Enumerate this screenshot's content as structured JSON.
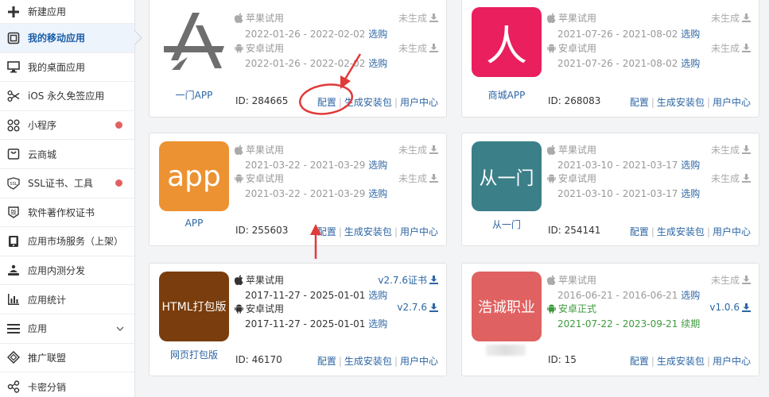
{
  "sidebar": {
    "items": [
      {
        "label": "新建应用",
        "icon": "plus-icon"
      },
      {
        "label": "我的移动应用",
        "icon": "mobile-app-icon",
        "active": true
      },
      {
        "label": "我的桌面应用",
        "icon": "desktop-icon"
      },
      {
        "label": "iOS 永久免签应用",
        "icon": "scissors-icon"
      },
      {
        "label": "小程序",
        "icon": "mini-program-icon",
        "dot": true
      },
      {
        "label": "云商城",
        "icon": "store-icon"
      },
      {
        "label": "SSL证书、工具",
        "icon": "ssl-icon",
        "dot": true
      },
      {
        "label": "软件著作权证书",
        "icon": "copyright-icon"
      },
      {
        "label": "应用市场服务（上架）",
        "icon": "market-icon"
      },
      {
        "label": "应用内测分发",
        "icon": "distribution-icon"
      },
      {
        "label": "应用统计",
        "icon": "bar-chart-icon"
      },
      {
        "label": "应用",
        "icon": "menu-icon",
        "chevron": true
      },
      {
        "label": "推广联盟",
        "icon": "diamond-icon"
      },
      {
        "label": "卡密分销",
        "icon": "share-icon"
      }
    ]
  },
  "labels": {
    "apple_trial": "苹果试用",
    "android_trial": "安卓试用",
    "android_official": "安卓正式",
    "not_generated": "未生成",
    "select_purchase": "选购",
    "renew": "续期",
    "config": "配置",
    "generate_package": "生成安装包",
    "user_center": "用户中心"
  },
  "apps": [
    {
      "name": "一门APP",
      "id": "ID: 284665",
      "apple_dates": "2022-01-26 - 2022-02-02",
      "android_dates": "2022-01-26 - 2022-02-02",
      "apple_status": "未生成",
      "android_status": "未生成"
    },
    {
      "name": "商城APP",
      "id": "ID: 268083",
      "icon_text": "人",
      "apple_dates": "2021-07-26 - 2021-08-02",
      "android_dates": "2021-07-26 - 2021-08-02",
      "apple_status": "未生成",
      "android_status": "未生成",
      "icon_color": "#ea1f5e"
    },
    {
      "name": "APP",
      "id": "ID: 255603",
      "icon_text": "app",
      "apple_dates": "2021-03-22 - 2021-03-29",
      "android_dates": "2021-03-22 - 2021-03-29",
      "apple_status": "未生成",
      "android_status": "未生成",
      "icon_color": "#ec9232"
    },
    {
      "name": "从一门",
      "id": "ID: 254141",
      "icon_text": "从一门",
      "apple_dates": "2021-03-10 - 2021-03-17",
      "android_dates": "2021-03-10 - 2021-03-17",
      "apple_status": "未生成",
      "android_status": "未生成",
      "icon_color": "#3b7f88"
    },
    {
      "name": "网页打包版",
      "id": "ID: 46170",
      "icon_text": "HTML打包版",
      "apple_dates": "2017-11-27 - 2025-01-01",
      "android_dates": "2017-11-27 - 2025-01-01",
      "apple_status": "v2.7.6证书",
      "android_status": "v2.7.6",
      "icon_color": "#7a3d0d"
    },
    {
      "name": "",
      "id": "ID: 15",
      "icon_text": "浩诚职业",
      "apple_dates": "2016-06-21 - 2016-06-21",
      "android_dates": "2021-07-22 - 2023-09-21",
      "apple_status": "未生成",
      "android_status": "v1.0.6",
      "icon_color": "#e06161"
    }
  ],
  "colors": {
    "link": "#2d66a4",
    "annotation": "#e03a3a",
    "muted": "#999999",
    "green": "#3f9a3f"
  }
}
